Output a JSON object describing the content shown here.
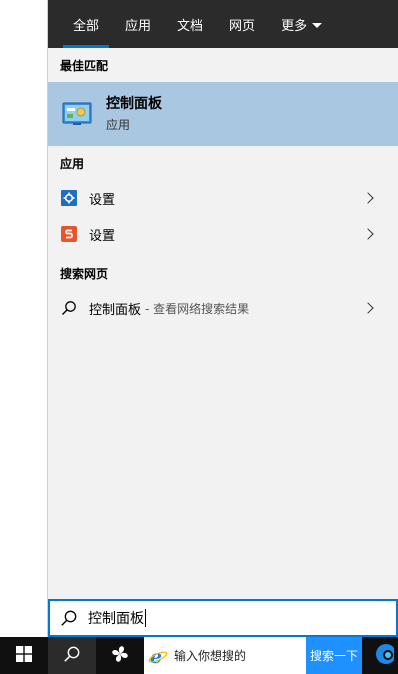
{
  "tabs": [
    {
      "label": "全部",
      "active": true
    },
    {
      "label": "应用"
    },
    {
      "label": "文档"
    },
    {
      "label": "网页"
    },
    {
      "label": "更多"
    }
  ],
  "sections": {
    "best_match": "最佳匹配",
    "apps": "应用",
    "web": "搜索网页"
  },
  "best_match_item": {
    "title": "控制面板",
    "subtitle": "应用",
    "icon": "control-panel-icon"
  },
  "app_items": [
    {
      "label": "设置",
      "icon": "settings-gear-icon"
    },
    {
      "label": "设置",
      "icon": "s-app-icon"
    }
  ],
  "web_item": {
    "label": "控制面板",
    "desc": "- 查看网络搜索结果",
    "icon": "search-icon"
  },
  "search_box": {
    "value": "控制面板"
  },
  "taskbar": {
    "search_placeholder": "输入你想搜的",
    "search_button": "搜索一下"
  },
  "colors": {
    "accent": "#0078d7",
    "selected_bg": "#a9c7e1",
    "tabbar_bg": "#2b2b2b",
    "panel_bg": "#f2f2f2",
    "taskbar_bg": "#101010"
  }
}
